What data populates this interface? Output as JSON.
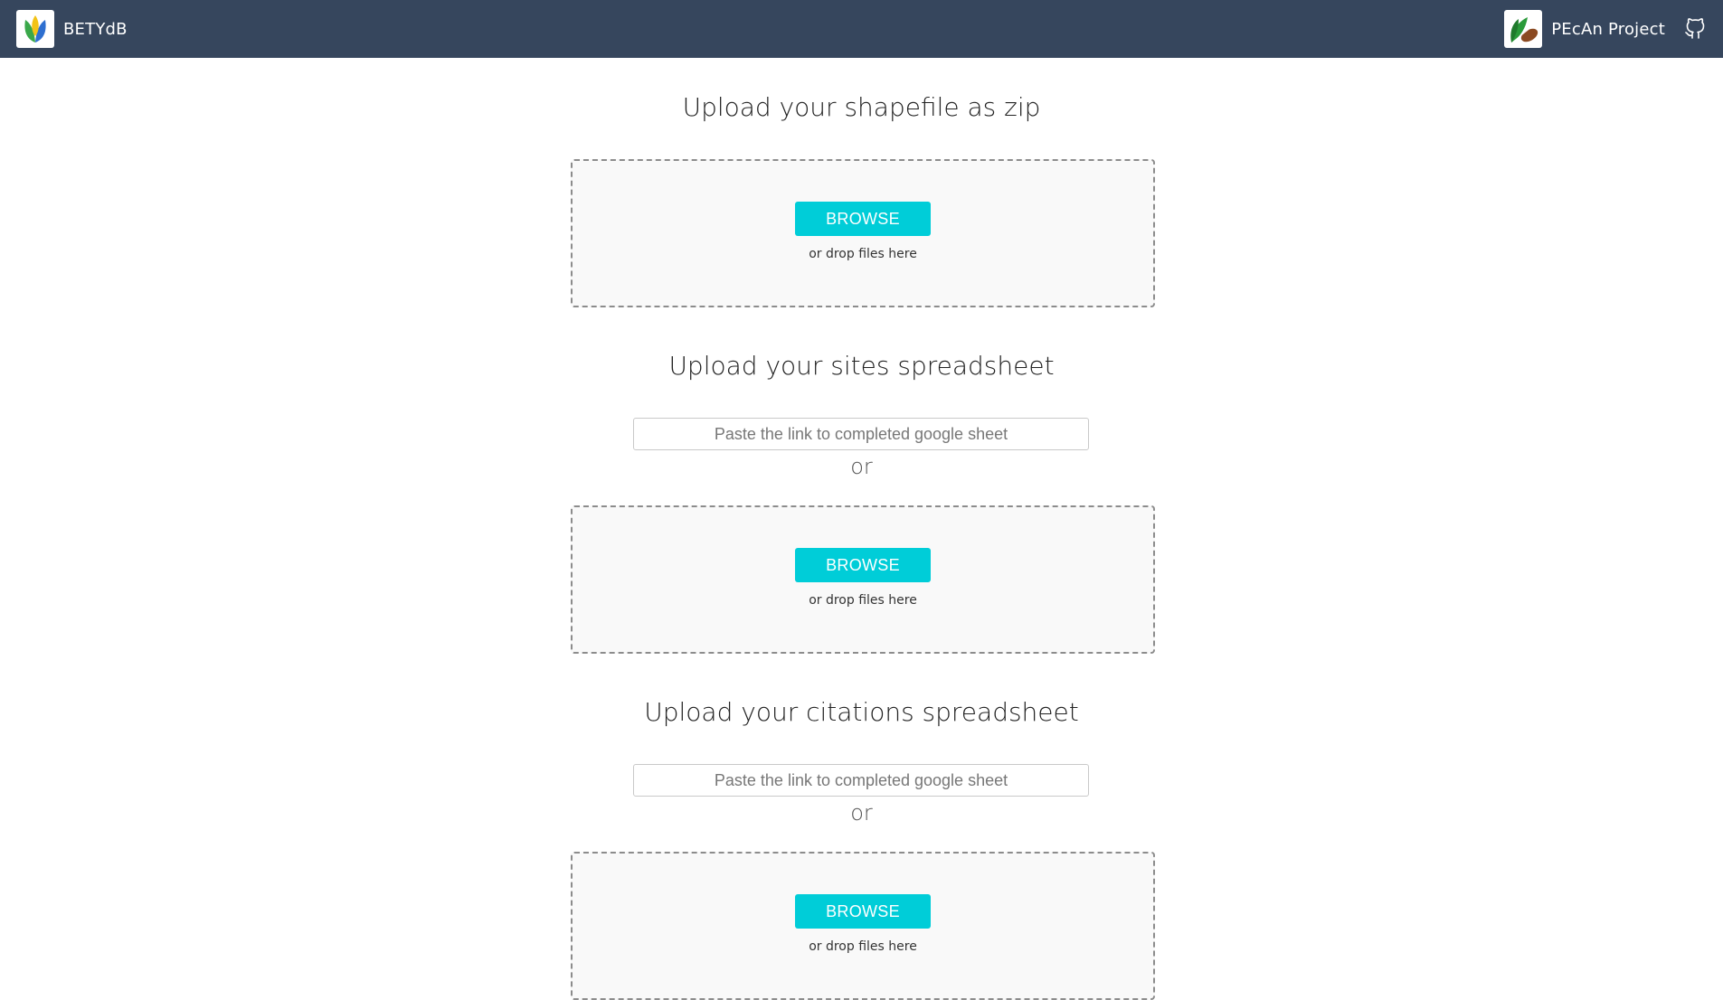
{
  "navbar": {
    "brand": "BETYdB",
    "project": "PEcAn Project"
  },
  "sections": {
    "shapefile": {
      "title": "Upload your shapefile as zip",
      "browse_label": "BROWSE",
      "drop_hint": "or drop files here"
    },
    "sites": {
      "title": "Upload your sites spreadsheet",
      "link_placeholder": "Paste the link to completed google sheet",
      "or_label": "or",
      "browse_label": "BROWSE",
      "drop_hint": "or drop files here"
    },
    "citations": {
      "title": "Upload your citations spreadsheet",
      "link_placeholder": "Paste the link to completed google sheet",
      "or_label": "or",
      "browse_label": "BROWSE",
      "drop_hint": "or drop files here"
    }
  },
  "colors": {
    "navbar_bg": "#36465d",
    "browse_button": "#00cdd8",
    "dropzone_border": "#8c8c8c",
    "dropzone_bg": "#f9f9f9"
  },
  "icons": {
    "brand_logo": "betydb-logo",
    "project_logo": "pecan-logo",
    "repo_link": "github-icon"
  }
}
